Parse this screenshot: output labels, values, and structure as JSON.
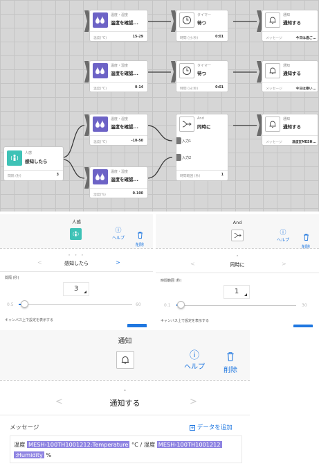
{
  "canvas": {
    "blocks": [
      {
        "id": "temp1",
        "sub": "温度・湿度",
        "name": "温度を確認...",
        "param_label": "温度(°C)",
        "param_value": "15-29"
      },
      {
        "id": "timer1",
        "sub": "タイマー",
        "name": "待つ",
        "param_label": "時間 (分:秒)",
        "param_value": "0:01"
      },
      {
        "id": "notify1",
        "sub": "通知",
        "name": "通知する",
        "param_label": "メッセージ",
        "param_value": "今日は過ご..."
      },
      {
        "id": "temp2",
        "sub": "温度・湿度",
        "name": "温度を確認...",
        "param_label": "温度(°C)",
        "param_value": "0-14"
      },
      {
        "id": "timer2",
        "sub": "タイマー",
        "name": "待つ",
        "param_label": "時間 (分:秒)",
        "param_value": "0:01"
      },
      {
        "id": "notify2",
        "sub": "通知",
        "name": "通知する",
        "param_label": "メッセージ",
        "param_value": "今日は寒い..."
      },
      {
        "id": "temp3",
        "sub": "温度・湿度",
        "name": "温度を確認...",
        "param_label": "温度(°C)",
        "param_value": "-10-50"
      },
      {
        "id": "and",
        "sub": "And",
        "name": "同時に",
        "param_label": "時間範囲 (秒)",
        "param_value": "1",
        "input1": "入力1",
        "input2": "入力2"
      },
      {
        "id": "notify3",
        "sub": "通知",
        "name": "通知する",
        "param_label": "メッセージ",
        "param_value": "温度[[MESH..."
      },
      {
        "id": "motion",
        "sub": "人感",
        "name": "感知したら",
        "param_label": "間隔 (秒)",
        "param_value": "3"
      },
      {
        "id": "hum",
        "sub": "温度・湿度",
        "name": "温度を確認...",
        "param_label": "湿度(%)",
        "param_value": "0-100"
      }
    ]
  },
  "motion_panel": {
    "title": "人感",
    "help_label": "ヘルプ",
    "delete_label": "削除",
    "event_label": "感知したら",
    "interval_label": "間隔 (秒)",
    "interval_value": "3",
    "slider_min": "0.5",
    "slider_max": "60",
    "slider_position": 0.05,
    "show_on_canvas_label": "キャンバス上で設定を表示する"
  },
  "and_panel": {
    "title": "And",
    "help_label": "ヘルプ",
    "delete_label": "削除",
    "event_label": "同時に",
    "range_label": "時間範囲 (秒)",
    "range_value": "1",
    "slider_min": "0.1",
    "slider_max": "30",
    "slider_position": 0.04,
    "show_on_canvas_label": "キャンバス上で設定を表示する"
  },
  "notify_panel": {
    "title": "通知",
    "help_label": "ヘルプ",
    "delete_label": "削除",
    "event_label": "通知する",
    "message_label": "メッセージ",
    "add_data_label": "データを追加",
    "msg_prefix": "温度",
    "tag_temperature": "MESH-100TH1001212:Temperature",
    "msg_middle": "°C / 湿度",
    "tag_humidity_part1": "MESH-100TH1001212",
    "tag_humidity_part2": ":Humidity",
    "msg_suffix": "%"
  },
  "colors": {
    "accent_blue": "#1f77e0",
    "temp_block_purple": "#6d63c6",
    "motion_block_teal": "#3ec2b6",
    "data_tag_purple": "#8f84e2"
  }
}
